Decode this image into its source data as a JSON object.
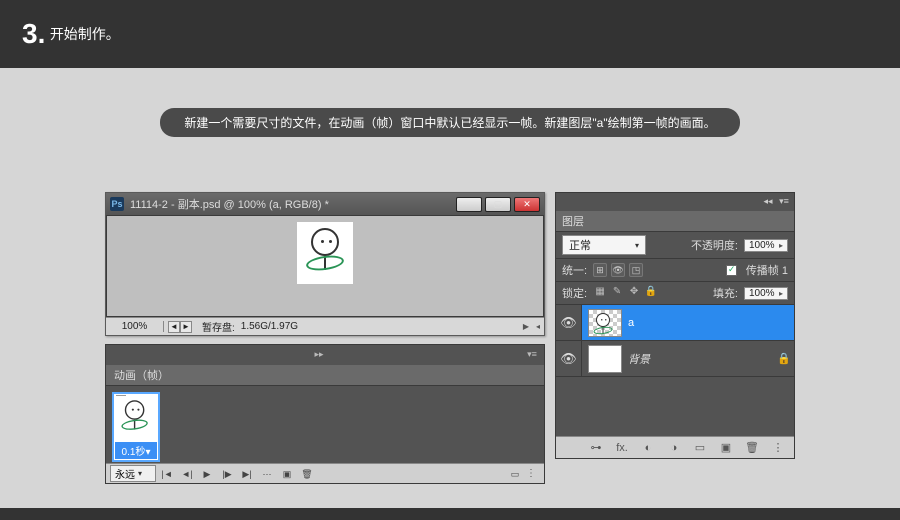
{
  "header": {
    "step_no": "3.",
    "step_text": "开始制作。"
  },
  "caption": "新建一个需要尺寸的文件，在动画（帧）窗口中默认已经显示一帧。新建图层\"a\"绘制第一帧的画面。",
  "document": {
    "title": "11114-2 - 副本.psd @ 100% (a, RGB/8) *",
    "zoom": "100%",
    "scratch_label": "暂存盘:",
    "scratch_value": "1.56G/1.97G"
  },
  "animation": {
    "tab": "动画（帧）",
    "frame": {
      "index": "1",
      "delay": "0.1秒",
      "delay_arrow": "▾"
    },
    "loop": "永远"
  },
  "layers": {
    "title": "图层",
    "blend": "正常",
    "opacity_label": "不透明度:",
    "opacity_value": "100%",
    "unify_label": "统一:",
    "propagate_label": "传播帧 1",
    "lock_label": "锁定:",
    "fill_label": "填充:",
    "fill_value": "100%",
    "items": [
      {
        "name": "a",
        "selected": true,
        "checker": true,
        "locked": false
      },
      {
        "name": "背景",
        "selected": false,
        "checker": false,
        "locked": true
      }
    ]
  }
}
